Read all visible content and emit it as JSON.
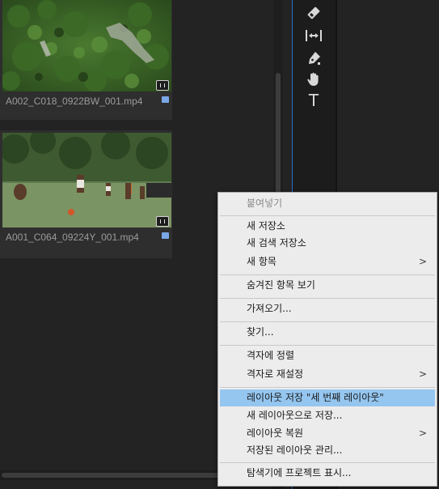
{
  "project_panel": {
    "clips": [
      {
        "name": "A002_C018_0922BW_001.mp4"
      },
      {
        "name": "A001_C064_09224Y_001.mp4"
      }
    ]
  },
  "tools": [
    {
      "icon": "razor-icon"
    },
    {
      "icon": "slip-icon"
    },
    {
      "icon": "pen-icon"
    },
    {
      "icon": "hand-icon"
    },
    {
      "icon": "type-icon",
      "glyph": "T"
    }
  ],
  "context_menu": {
    "items": [
      {
        "label": "붙여넣기",
        "disabled": true
      },
      {
        "label": "새 저장소"
      },
      {
        "label": "새 검색 저장소"
      },
      {
        "label": "새 항목",
        "submenu": true
      },
      {
        "label": "숨겨진 항목 보기"
      },
      {
        "label": "가져오기..."
      },
      {
        "label": "찾기..."
      },
      {
        "label": "격자에 정렬"
      },
      {
        "label": "격자로 재설정",
        "submenu": true
      },
      {
        "label": "레이아웃 저장 \"세 번째 레이아웃\"",
        "highlighted": true
      },
      {
        "label": "새 레이아웃으로 저장..."
      },
      {
        "label": "레이아웃 복원",
        "submenu": true
      },
      {
        "label": "저장된 레이아웃 관리..."
      },
      {
        "label": "탐색기에 프로젝트 표시..."
      }
    ],
    "submenu_glyph": ">"
  },
  "colors": {
    "accent_line": "#2d6dc9",
    "menu_highlight": "#95c6f0",
    "clip_marker": "#7aa7e6"
  }
}
